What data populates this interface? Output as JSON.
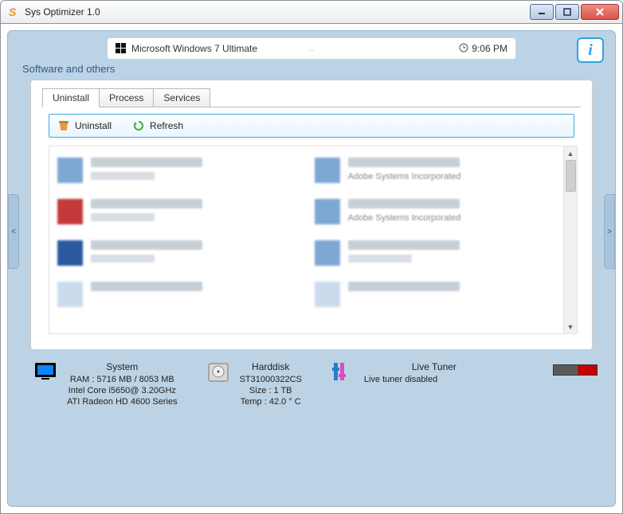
{
  "window": {
    "title": "Sys Optimizer 1.0"
  },
  "topbar": {
    "os": "Microsoft Windows 7 Ultimate",
    "time": "9:06 PM"
  },
  "section_title": "Software and others",
  "tabs": {
    "uninstall": "Uninstall",
    "process": "Process",
    "services": "Services"
  },
  "toolbar": {
    "uninstall": "Uninstall",
    "refresh": "Refresh"
  },
  "list": {
    "vendor_adobe": "Adobe Systems Incorporated",
    "vendor_adobe2": "Adobe Systems Incorporated"
  },
  "status": {
    "system": {
      "title": "System",
      "ram": "RAM : 5716 MB / 8053 MB",
      "cpu": "Intel Core i5650@ 3.20GHz",
      "gpu": "ATI Radeon HD 4600 Series"
    },
    "harddisk": {
      "title": "Harddisk",
      "model": "ST31000322CS",
      "size": "Size : 1 TB",
      "temp": "Temp : 42.0 ° C"
    },
    "livetuner": {
      "title": "Live Tuner",
      "status": "Live tuner disabled"
    }
  },
  "side": {
    "left": "<",
    "right": ">"
  }
}
